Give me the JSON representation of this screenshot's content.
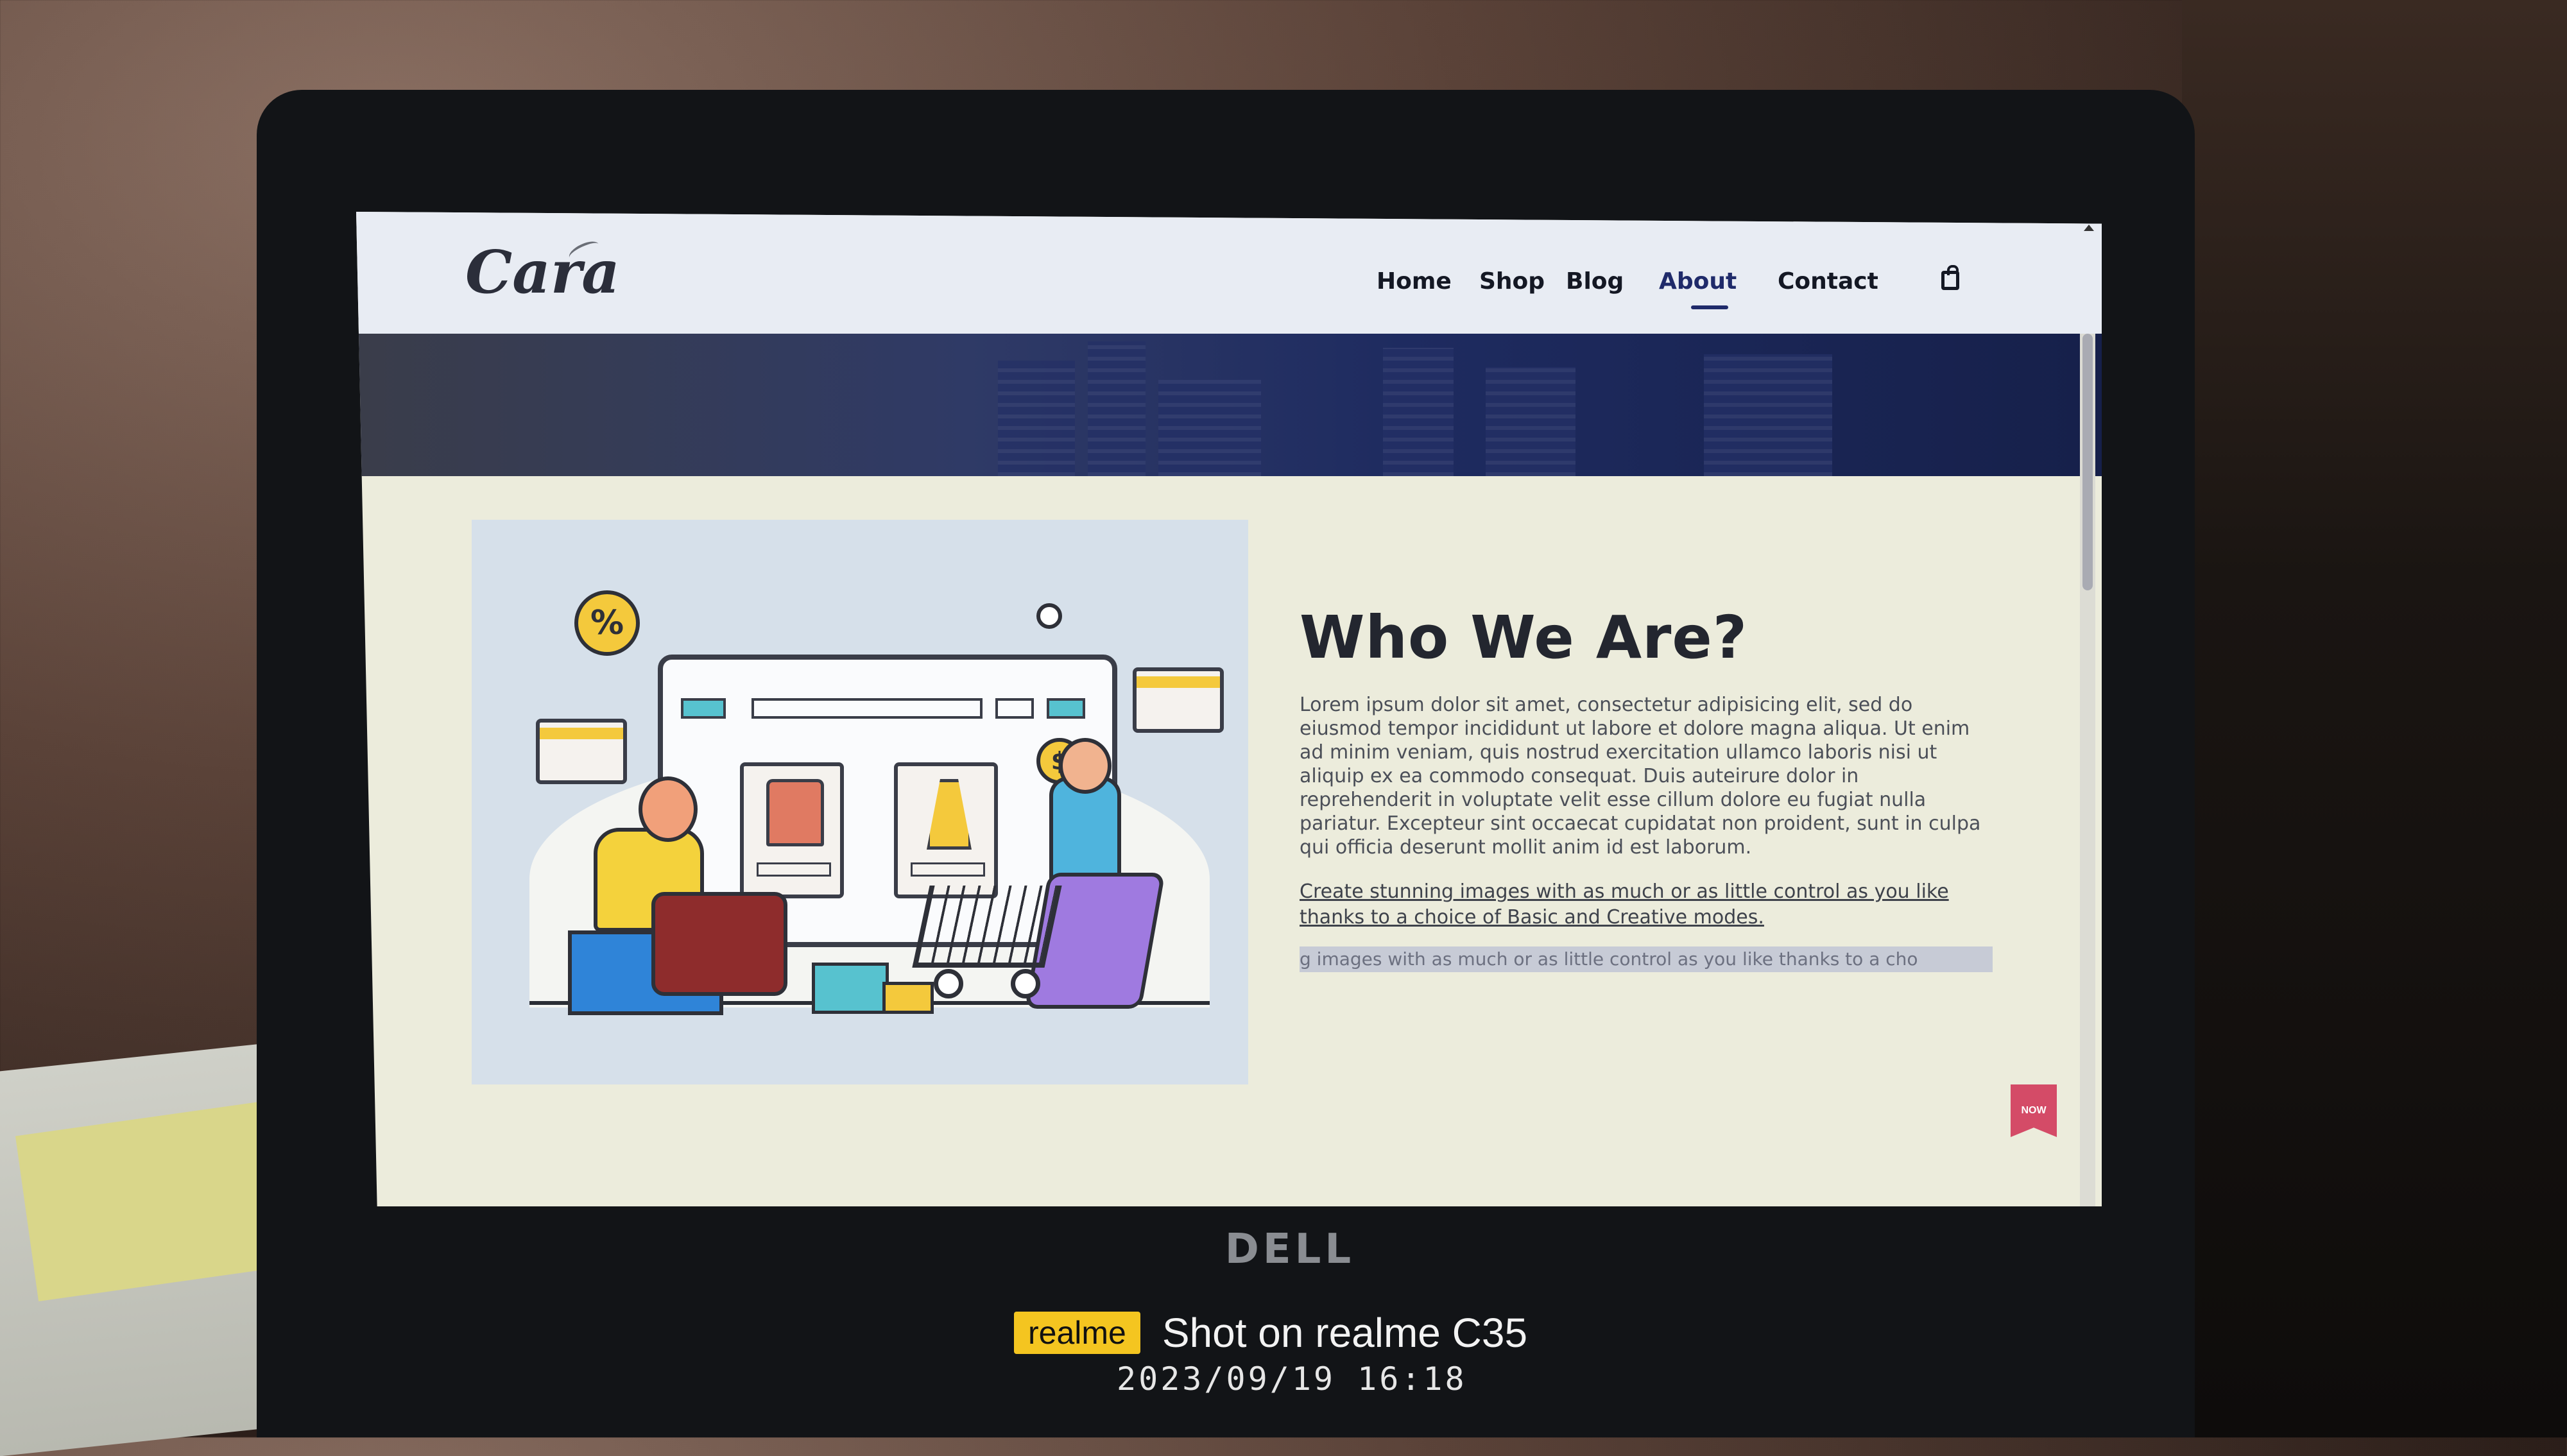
{
  "site": {
    "logo": "Cara",
    "nav": [
      "Home",
      "Shop",
      "Blog",
      "About",
      "Contact"
    ],
    "active_nav": "About",
    "cart_icon": "shopping-bag-icon"
  },
  "about": {
    "title": "Who We Are?",
    "body": "Lorem ipsum dolor sit amet, consectetur adipisicing elit, sed do eiusmod tempor incididunt ut labore et dolore magna aliqua. Ut enim ad minim veniam, quis nostrud exercitation ullamco laboris nisi ut aliquip ex ea commodo consequat. Duis auteirure dolor in reprehenderit in voluptate velit esse cillum dolore eu fugiat nulla pariatur. Excepteur sint occaecat cupidatat non proident, sunt in culpa qui officia deserunt mollit anim id est laborum.",
    "link_text": "Create stunning images with as much or as little control as you like thanks to a choice of Basic and Creative modes.",
    "marquee_text": "g images with as much or as little control as you like thanks to a cho",
    "badge": "NOW"
  },
  "illustration": {
    "percent_symbol": "%",
    "dollar_symbol": "$"
  },
  "device": {
    "brand": "DELL"
  },
  "watermark": {
    "brand": "realme",
    "text": "Shot on realme C35",
    "datetime": "2023/09/19  16:18"
  },
  "colors": {
    "nav_active": "#1f2a6a",
    "accent_yellow": "#f4c93c",
    "accent_blue": "#2f84d8",
    "badge_pink": "#d44b67"
  }
}
